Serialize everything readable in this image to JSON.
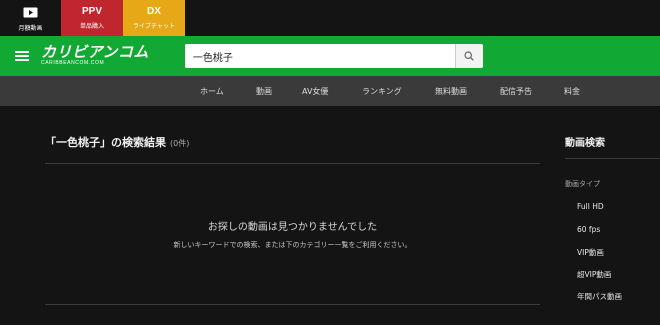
{
  "services": {
    "video": {
      "label": "月額動画",
      "icon": "play-icon"
    },
    "ppv": {
      "big": "PPV",
      "label": "単品購入"
    },
    "live": {
      "big": "DX",
      "label": "ライブチャット"
    }
  },
  "header": {
    "logo_jp": "カリビアンコム",
    "logo_en": "CARIBBEANCOM.COM",
    "search_value": "一色桃子"
  },
  "nav": {
    "items": [
      "ホーム",
      "動画",
      "AV女優",
      "ランキング",
      "無料動画",
      "配信予告",
      "料金"
    ]
  },
  "results": {
    "title": "「一色桃子」の検索結果",
    "count": "(0件)",
    "empty_message": "お探しの動画は見つかりませんでした",
    "empty_sub": "新しいキーワードでの検索、または下のカテゴリー一覧をご利用ください。"
  },
  "sidebar": {
    "title": "動画検索",
    "section": "動画タイプ",
    "items": [
      "Full HD",
      "60 fps",
      "VIP動画",
      "超VIP動画",
      "年間パス動画"
    ]
  },
  "colors": {
    "header_green": "#11a834",
    "ppv_red": "#c0262d",
    "live_yellow": "#e6a817",
    "nav_bg": "#3a3a3a",
    "page_bg": "#141414"
  }
}
